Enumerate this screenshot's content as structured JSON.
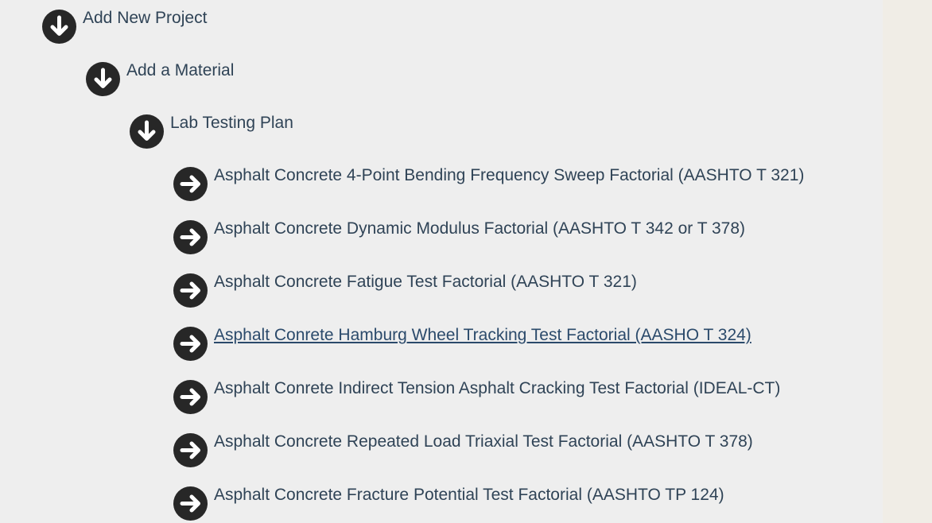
{
  "tree": {
    "level1": {
      "label": "Add New Project",
      "icon": "arrow-down-circle-icon"
    },
    "level2": {
      "label": "Add a Material",
      "icon": "arrow-down-circle-icon"
    },
    "level3": {
      "label": "Lab Testing Plan",
      "icon": "arrow-down-circle-icon"
    },
    "items": [
      {
        "label": "Asphalt Concrete 4-Point Bending Frequency Sweep Factorial (AASHTO T 321)",
        "icon": "arrow-right-circle-icon",
        "underlined": false
      },
      {
        "label": "Asphalt Concrete Dynamic Modulus Factorial (AASHTO T 342 or T 378)",
        "icon": "arrow-right-circle-icon",
        "underlined": false
      },
      {
        "label": "Asphalt Concrete Fatigue Test Factorial (AASHTO T 321)",
        "icon": "arrow-right-circle-icon",
        "underlined": false
      },
      {
        "label": "Asphalt Conrete Hamburg Wheel Tracking Test Factorial (AASHO T 324)",
        "icon": "arrow-right-circle-icon",
        "underlined": true
      },
      {
        "label": "Asphalt Conrete Indirect Tension Asphalt Cracking Test Factorial (IDEAL-CT)",
        "icon": "arrow-right-circle-icon",
        "underlined": false
      },
      {
        "label": "Asphalt Concrete Repeated Load Triaxial Test Factorial (AASHTO T 378)",
        "icon": "arrow-right-circle-icon",
        "underlined": false
      },
      {
        "label": "Asphalt Concrete Fracture Potential Test Factorial (AASHTO TP 124)",
        "icon": "arrow-right-circle-icon",
        "underlined": false
      }
    ]
  },
  "colors": {
    "panel_background": "#eeeeee",
    "page_background": "#f0ede6",
    "icon_circle": "#272727",
    "icon_arrow": "#ffffff",
    "text": "#2f4356"
  }
}
